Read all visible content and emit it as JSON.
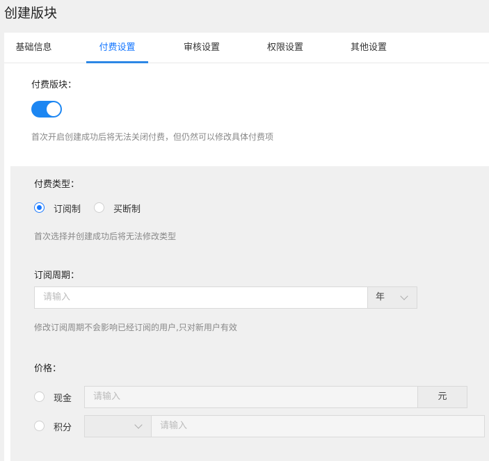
{
  "page": {
    "title": "创建版块"
  },
  "tabs": [
    {
      "label": "基础信息"
    },
    {
      "label": "付费设置"
    },
    {
      "label": "审核设置"
    },
    {
      "label": "权限设置"
    },
    {
      "label": "其他设置"
    }
  ],
  "paid": {
    "label": "付费版块：",
    "enabled": true,
    "hint": "首次开启创建成功后将无法关闭付费，但仍然可以修改具体付费项"
  },
  "pay_type": {
    "label": "付费类型：",
    "options": [
      {
        "label": "订阅制",
        "checked": true
      },
      {
        "label": "买断制",
        "checked": false
      }
    ],
    "hint": "首次选择并创建成功后将无法修改类型"
  },
  "period": {
    "label": "订阅周期：",
    "placeholder": "请输入",
    "unit": "年",
    "hint": "修改订阅周期不会影响已经订阅的用户,只对新用户有效"
  },
  "price": {
    "label": "价格：",
    "cash": {
      "label": "现金",
      "placeholder": "请输入",
      "unit": "元"
    },
    "points": {
      "label": "积分",
      "placeholder": "请输入",
      "select_value": ""
    }
  },
  "colors": {
    "accent": "#1677ff",
    "switch_on": "#1c86f2"
  }
}
